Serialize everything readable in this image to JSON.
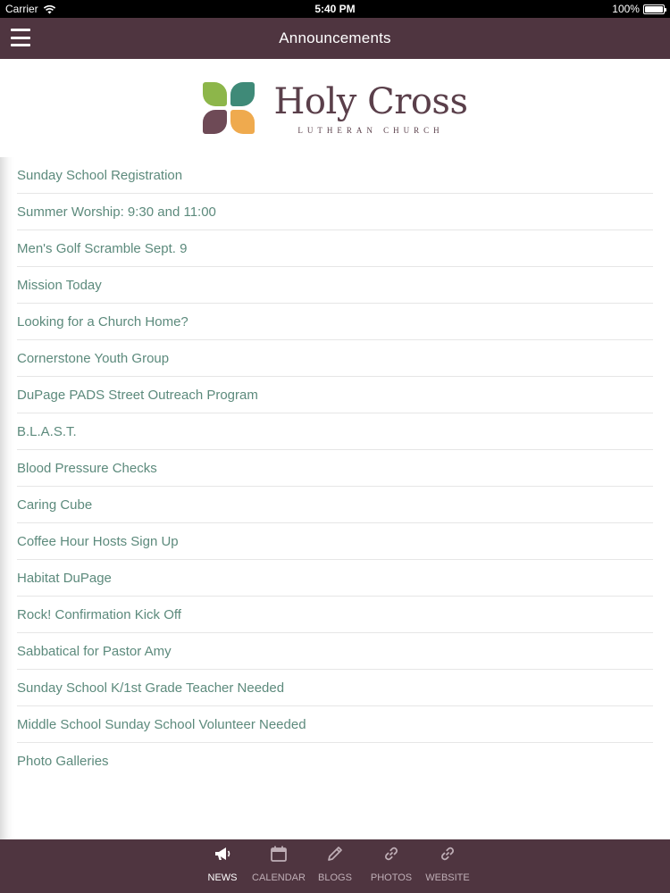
{
  "status_bar": {
    "carrier": "Carrier",
    "time": "5:40 PM",
    "battery": "100%",
    "battery_level": 1.0
  },
  "nav": {
    "title": "Announcements"
  },
  "logo": {
    "name": "Holy Cross",
    "subtitle": "LUTHERAN CHURCH"
  },
  "announcements": [
    "Sunday School Registration",
    "Summer Worship: 9:30 and 11:00",
    "Men's Golf Scramble Sept. 9",
    "Mission Today",
    "Looking for a Church Home?",
    "Cornerstone Youth Group",
    "DuPage PADS Street Outreach Program",
    "B.L.A.S.T.",
    "Blood Pressure Checks",
    "Caring Cube",
    "Coffee Hour Hosts Sign Up",
    "Habitat DuPage",
    "Rock! Confirmation Kick Off",
    "Sabbatical for Pastor Amy",
    "Sunday School K/1st Grade Teacher Needed",
    "Middle School Sunday School Volunteer Needed",
    "Photo Galleries"
  ],
  "tabs": [
    {
      "label": "NEWS",
      "icon": "megaphone-icon",
      "active": true
    },
    {
      "label": "CALENDAR",
      "icon": "calendar-icon",
      "active": false
    },
    {
      "label": "BLOGS",
      "icon": "pencil-icon",
      "active": false
    },
    {
      "label": "PHOTOS",
      "icon": "link-icon",
      "active": false
    },
    {
      "label": "WEBSITE",
      "icon": "link-icon",
      "active": false
    }
  ],
  "colors": {
    "bar_background": "#4f3540",
    "link_text": "#5c8a7c",
    "tab_inactive": "#bfaeb6",
    "tab_active": "#ffffff"
  }
}
